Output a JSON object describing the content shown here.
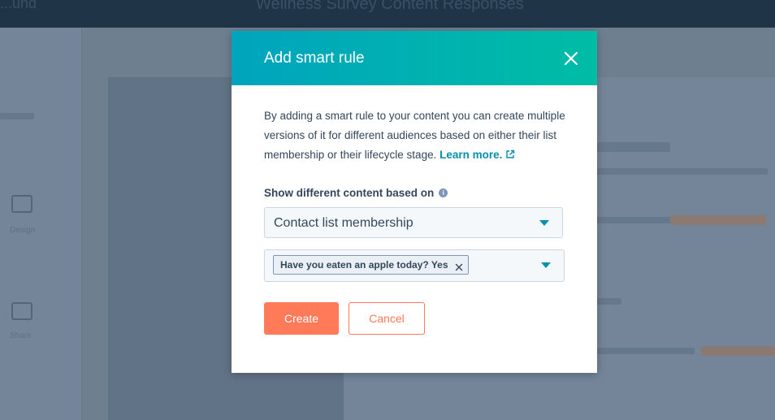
{
  "background": {
    "brand_text": "...und",
    "page_title": "Wellness Survey Content Responses",
    "left_labels": [
      "Design",
      "Share"
    ]
  },
  "modal": {
    "title": "Add smart rule",
    "description": "By adding a smart rule to your content you can create multiple versions of it for different audiences based on either their list membership or their lifecycle stage.",
    "learn_more": "Learn more.",
    "section_label": "Show different content based on",
    "rule_type_value": "Contact list membership",
    "selected_tag": "Have you eaten an apple today? Yes",
    "create_label": "Create",
    "cancel_label": "Cancel"
  },
  "colors": {
    "header_gradient_start": "#00a4bd",
    "header_gradient_end": "#00bda5",
    "accent_orange": "#ff7a59",
    "link_teal": "#0091ae",
    "text_dark": "#33475b"
  },
  "icons": {
    "close": "close-icon",
    "external_link": "external-link-icon",
    "info": "info-icon",
    "dropdown": "chevron-down-icon",
    "tag_remove": "remove-tag-icon"
  }
}
